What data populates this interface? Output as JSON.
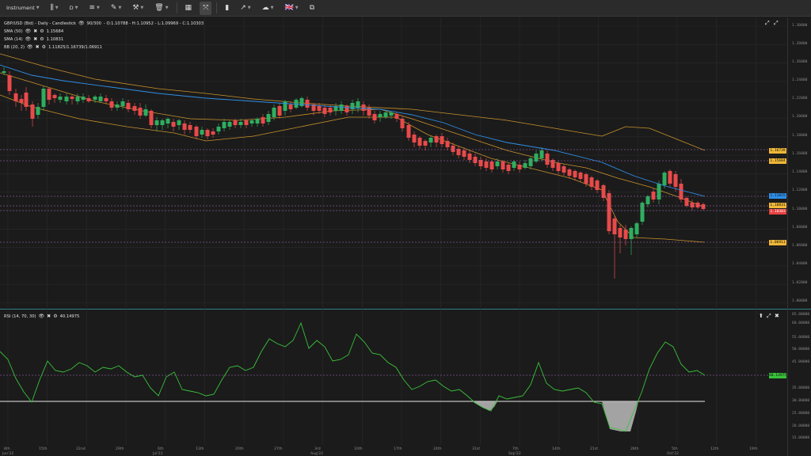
{
  "toolbar": {
    "instrument_label": "Instrument",
    "timeframe_label": "D",
    "flag_icon_text": "🇬🇧"
  },
  "legend": {
    "header": "GBP/USD (Bid) - Daily - Candlestick",
    "bars": "90/300",
    "ohlc": "- O:1.10788 - H:1.10952 - L:1.09969 - C:1.10303",
    "sma50_name": "SMA (50)",
    "sma50_value": "1.15684",
    "sma14_name": "SMA (14)",
    "sma14_value": "1.10831",
    "bb_name": "BB (20, 2)",
    "bb_value": "1.11825/1.16739/1.06911"
  },
  "price_axis": {
    "ticks": [
      "1.30000",
      "1.28000",
      "1.26000",
      "1.24000",
      "1.22000",
      "1.20000",
      "1.18000",
      "1.16000",
      "1.14000",
      "1.12000",
      "1.10000",
      "1.08000",
      "1.06000",
      "1.04000",
      "1.02000",
      "1.00000"
    ],
    "tags": [
      {
        "text": "1.16739",
        "color": "#f0b838"
      },
      {
        "text": "1.15684",
        "color": "#f0b838"
      },
      {
        "text": "1.11825",
        "color": "#2e8fe8"
      },
      {
        "text": "1.10831",
        "color": "#f0b838"
      },
      {
        "text": "1.10303",
        "color": "#e84040"
      },
      {
        "text": "1.06911",
        "color": "#f0b838"
      }
    ]
  },
  "rsi": {
    "name": "RSI (14, 70, 30)",
    "value": "40.14975",
    "ticks": [
      "65.00000",
      "60.00000",
      "55.00000",
      "50.00000",
      "45.00000",
      "40.00000",
      "35.00000",
      "30.00000",
      "25.00000",
      "20.00000",
      "15.00000"
    ],
    "tag": {
      "text": "40.14975",
      "color": "#39c23a"
    }
  },
  "time_axis": {
    "labels": [
      "8th",
      "15th",
      "22nd",
      "29th",
      "6th",
      "13th",
      "20th",
      "27th",
      "3rd",
      "10th",
      "17th",
      "24th",
      "31st",
      "7th",
      "14th",
      "21st",
      "28th",
      "5th",
      "12th",
      "19th"
    ],
    "month_labels": [
      "Jun'22",
      "Jul'22",
      "Aug'22",
      "Sep'22",
      "Oct'22"
    ]
  },
  "colors": {
    "up": "#2fae5f",
    "down": "#e84a4a",
    "sma50": "#2e8fe8",
    "bb": "#c9922b",
    "rsi": "#39c23a",
    "grid": "#2a2a2a"
  }
}
